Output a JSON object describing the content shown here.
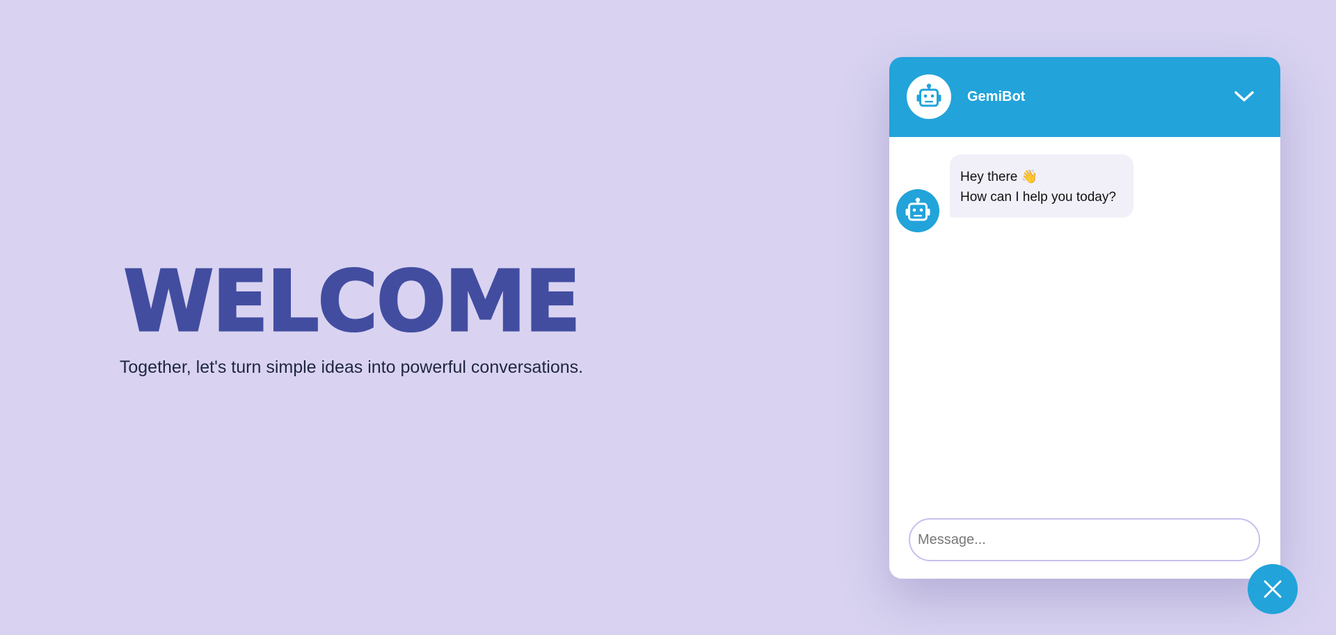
{
  "hero": {
    "title": "WELCOME",
    "subtitle": "Together, let's turn simple ideas into powerful conversations."
  },
  "chat": {
    "title": "GemiBot",
    "header_icon": "robot-icon",
    "collapse_icon": "chevron-down-icon",
    "messages": [
      {
        "sender": "bot",
        "avatar_icon": "robot-icon",
        "line1": "Hey there 👋",
        "line2": "How can I help you today?"
      }
    ],
    "input": {
      "placeholder": "Message...",
      "value": ""
    },
    "close_icon": "close-icon"
  },
  "colors": {
    "background": "#d9d3f1",
    "accent": "#22a3da",
    "headline": "#434da0",
    "bubble": "#f1f0f8",
    "input_border": "#c7c0ef"
  }
}
